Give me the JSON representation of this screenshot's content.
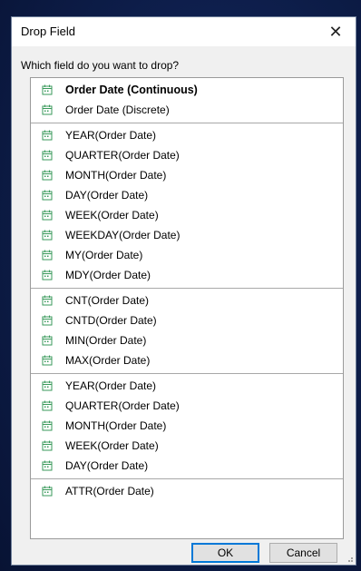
{
  "dialog": {
    "title": "Drop Field",
    "close_glyph": "✕",
    "prompt": "Which field do you want to drop?",
    "ok_label": "OK",
    "cancel_label": "Cancel"
  },
  "icon": {
    "name": "calendar-icon",
    "color": "#3a9a5b"
  },
  "groups": [
    {
      "items": [
        {
          "label": "Order Date (Continuous)",
          "bold": true
        },
        {
          "label": "Order Date (Discrete)"
        }
      ]
    },
    {
      "items": [
        {
          "label": "YEAR(Order Date)"
        },
        {
          "label": "QUARTER(Order Date)"
        },
        {
          "label": "MONTH(Order Date)"
        },
        {
          "label": "DAY(Order Date)"
        },
        {
          "label": "WEEK(Order Date)"
        },
        {
          "label": "WEEKDAY(Order Date)"
        },
        {
          "label": "MY(Order Date)"
        },
        {
          "label": "MDY(Order Date)"
        }
      ]
    },
    {
      "items": [
        {
          "label": "CNT(Order Date)"
        },
        {
          "label": "CNTD(Order Date)"
        },
        {
          "label": "MIN(Order Date)"
        },
        {
          "label": "MAX(Order Date)"
        }
      ]
    },
    {
      "items": [
        {
          "label": "YEAR(Order Date)"
        },
        {
          "label": "QUARTER(Order Date)"
        },
        {
          "label": "MONTH(Order Date)"
        },
        {
          "label": "WEEK(Order Date)"
        },
        {
          "label": "DAY(Order Date)"
        }
      ]
    },
    {
      "items": [
        {
          "label": "ATTR(Order Date)"
        }
      ]
    }
  ]
}
